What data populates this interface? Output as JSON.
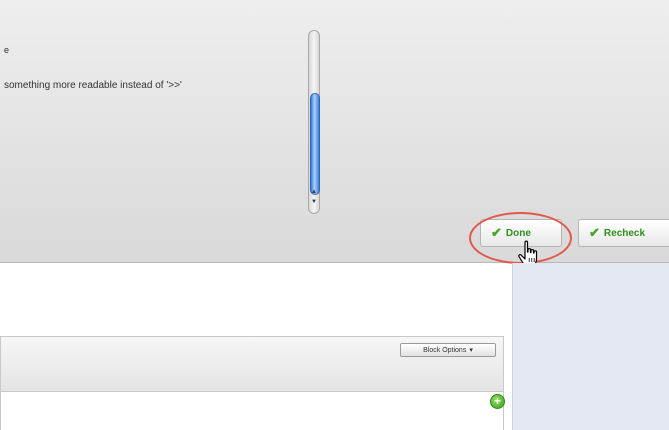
{
  "top_panel": {
    "line_1": "e",
    "line_2": "something more readable instead of '>>'"
  },
  "buttons": {
    "done_label": "Done",
    "recheck_label": "Recheck"
  },
  "block": {
    "options_label": "Block Options",
    "options_arrow": "▾"
  },
  "icons": {
    "check": "✔",
    "add": "+",
    "scroll_up": "▲",
    "scroll_down": "▼"
  },
  "colors": {
    "check_green": "#47a726",
    "label_green": "#2f8f1f",
    "highlight_red": "#e05a4b",
    "scroll_blue": "#3d7bd9",
    "side_panel": "#e4e8f2"
  }
}
